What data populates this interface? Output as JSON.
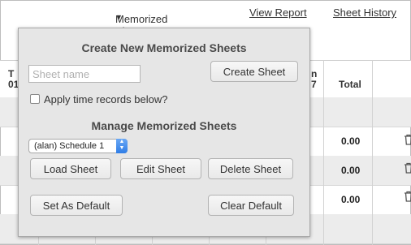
{
  "topbar": {
    "memorized_label": "Memorized Sheets",
    "view_report": "View Report",
    "sheet_history": "Sheet History"
  },
  "table": {
    "col_first_header": "T\n01/",
    "col_last_header": "n\n7",
    "total_header": "Total",
    "rows": [
      {
        "total": ""
      },
      {
        "total": "0.00"
      },
      {
        "total": "0.00"
      },
      {
        "total": "0.00"
      },
      {
        "total": ""
      }
    ]
  },
  "popover": {
    "create_heading": "Create New Memorized Sheets",
    "name_placeholder": "Sheet name",
    "create_button": "Create Sheet",
    "apply_time_label": "Apply time records below?",
    "manage_heading": "Manage Memorized Sheets",
    "selected_sheet": "(alan) Schedule 1",
    "load_button": "Load Sheet",
    "edit_button": "Edit Sheet",
    "delete_button": "Delete Sheet",
    "set_default_button": "Set As Default",
    "clear_default_button": "Clear Default"
  },
  "icons": {
    "caret": "caret-down-icon",
    "trash": "trash-icon",
    "select_arrows": "select-arrows-icon"
  },
  "colors": {
    "select_accent": "#2f7de6",
    "popover_bg": "#e6e6e6"
  }
}
